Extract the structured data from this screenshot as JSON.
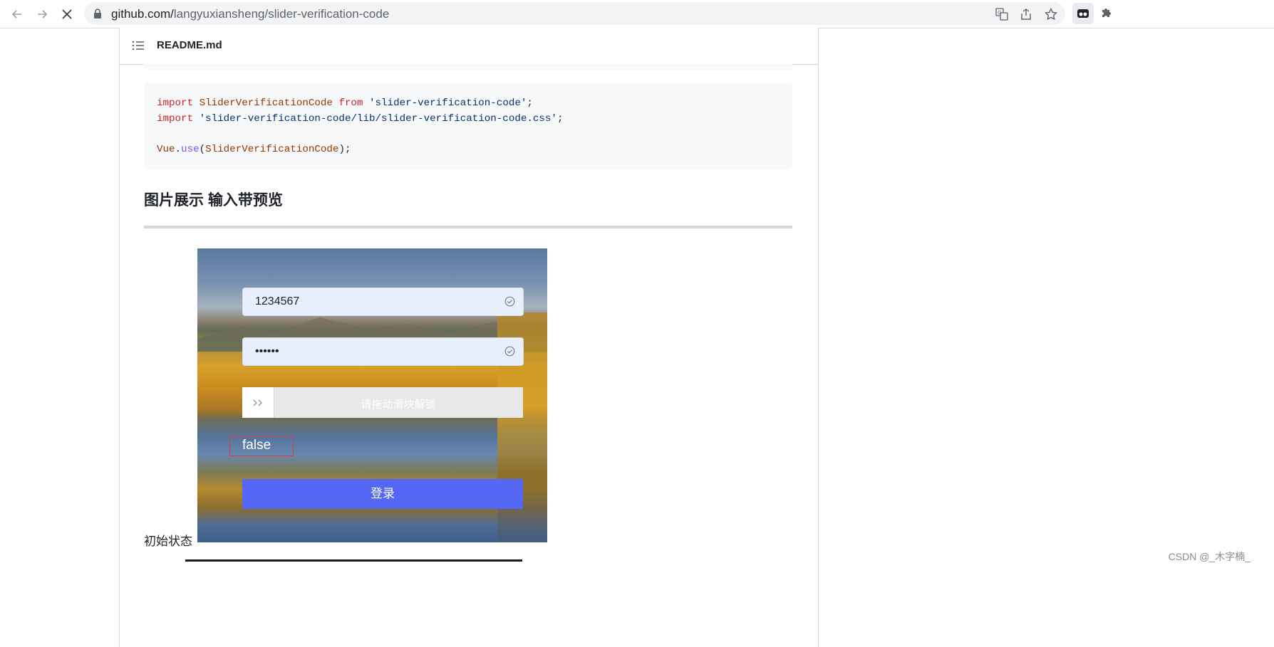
{
  "browser": {
    "url_host": "github.com/",
    "url_path": "langyuxiansheng/slider-verification-code"
  },
  "readme": {
    "title": "README.md",
    "code_lines": [
      {
        "kw": "import",
        "ent": "SliderVerificationCode",
        "kw2": "from",
        "str": "'slider-verification-code'",
        "end": ";"
      },
      {
        "kw": "import",
        "str": "'slider-verification-code/lib/slider-verification-code.css'",
        "end": ";"
      },
      {
        "obj": "Vue",
        "fn": "use",
        "arg": "SliderVerificationCode",
        "end": ");"
      }
    ],
    "section_title": "图片展示 输入带预览",
    "caption": "初始状态"
  },
  "demo": {
    "username": "1234567",
    "password": "••••••",
    "slider_hint": "请拖动滑块解锁",
    "status": "false",
    "login_label": "登录"
  },
  "watermark": "CSDN @_木字楠_"
}
